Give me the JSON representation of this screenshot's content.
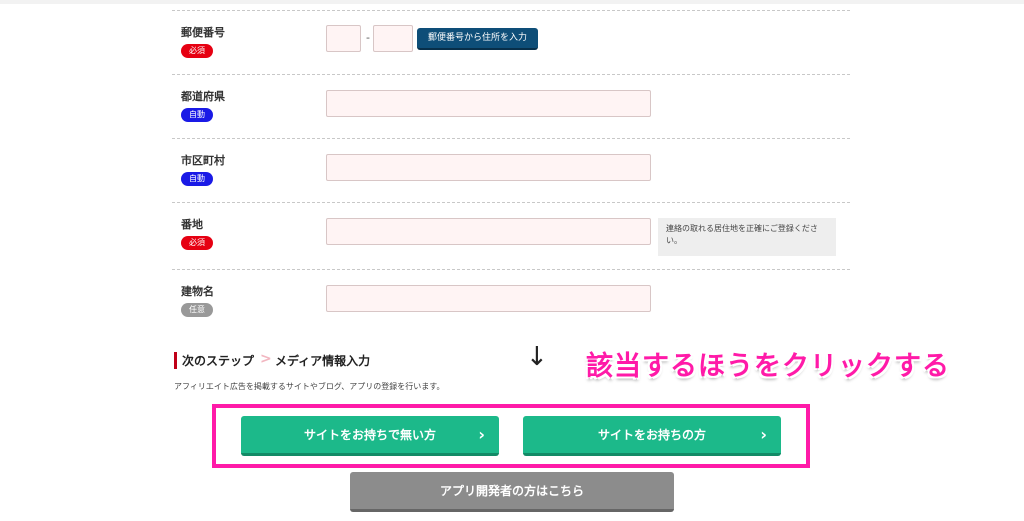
{
  "form": {
    "postal": {
      "label": "郵便番号",
      "badge": "必須",
      "lookup_button": "郵便番号から住所を入力",
      "separator": "-"
    },
    "prefecture": {
      "label": "都道府県",
      "badge": "自動"
    },
    "city": {
      "label": "市区町村",
      "badge": "自動"
    },
    "street": {
      "label": "番地",
      "badge": "必須",
      "hint": "連絡の取れる居住地を正確にご登録ください。"
    },
    "building": {
      "label": "建物名",
      "badge": "任意"
    }
  },
  "next_step": {
    "prefix": "次のステップ",
    "arrow": ">",
    "name": "メディア情報入力",
    "description": "アフィリエイト広告を掲載するサイトやブログ、アプリの登録を行います。"
  },
  "annotation": {
    "arrow": "↓",
    "callout": "該当するほうをクリックする",
    "highlight_color": "#ff1aa8"
  },
  "buttons": {
    "no_site": "サイトをお持ちで無い方",
    "has_site": "サイトをお持ちの方",
    "chevron": "›",
    "app_developer": "アプリ開発者の方はこちら"
  },
  "colors": {
    "required_badge": "#e60012",
    "auto_badge": "#1a1ae6",
    "optional_badge": "#999999",
    "primary_green": "#1cb98a",
    "lookup_button": "#0e4e78",
    "input_bg": "#fff4f4"
  }
}
